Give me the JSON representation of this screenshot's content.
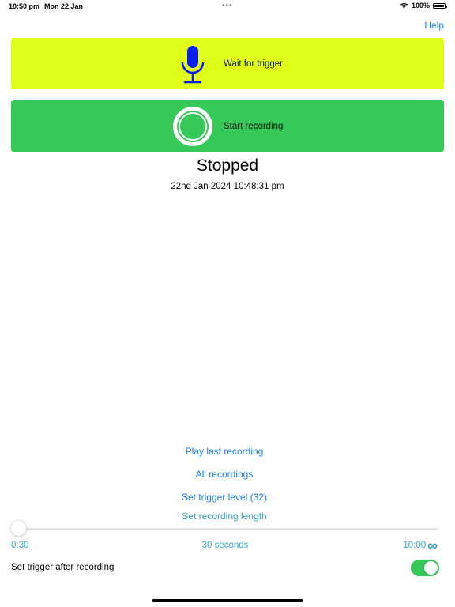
{
  "status_bar": {
    "time": "10:50 pm",
    "date": "Mon 22 Jan",
    "dots": "•••",
    "battery_text": "100%"
  },
  "header": {
    "help_label": "Help"
  },
  "buttons": {
    "trigger": {
      "label": "Wait for trigger",
      "background": "#dfff1a",
      "icon": "microphone-icon",
      "icon_color": "#0a1ef0"
    },
    "record": {
      "label": "Start recording",
      "background": "#36c95a",
      "icon": "record-circle-icon"
    }
  },
  "state": {
    "title": "Stopped",
    "timestamp": "22nd Jan 2024 10:48:31 pm"
  },
  "links": {
    "play_last": "Play last recording",
    "all_recordings": "All recordings",
    "trigger_level": "Set trigger level (32)",
    "recording_length": "Set recording length"
  },
  "slider": {
    "min_label": "0:30",
    "current_label": "30 seconds",
    "max_label": "10:00",
    "max_suffix": "∞",
    "fraction": 0
  },
  "toggle": {
    "label": "Set trigger after recording",
    "on": true,
    "color": "#36c95a"
  },
  "colors": {
    "accent": "#1a7ff0",
    "secondary_accent": "#36a3c4"
  }
}
